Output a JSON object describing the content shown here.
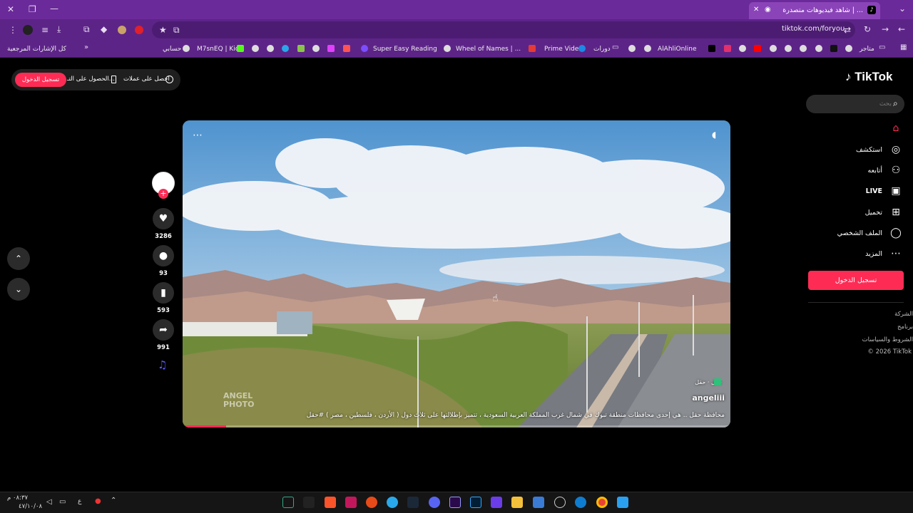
{
  "browser": {
    "tab_title": "شاهد فيديوهات متصدرة | ...",
    "url": "tiktok.com/foryou",
    "bookmarks": [
      "كل الإشارات المرجعية",
      "حسابي",
      "M7snEQ | Kick",
      "Super Easy Reading",
      "Wheel of Names | ...",
      "Prime Video",
      "دورات",
      "AlAhliOnline",
      "متاجر"
    ]
  },
  "promo": {
    "login": "تسجيل الدخول",
    "get_app": "الحصول على التـ...",
    "get_coins": "احصل على عملات"
  },
  "sidebar": {
    "logo": "TikTok",
    "search_placeholder": "بحث",
    "items": [
      {
        "label": "",
        "icon": "home-icon"
      },
      {
        "label": "استكشف",
        "icon": "compass-icon"
      },
      {
        "label": "أتابعه",
        "icon": "following-icon"
      },
      {
        "label": "LIVE",
        "icon": "live-icon"
      },
      {
        "label": "تحميل",
        "icon": "upload-icon"
      },
      {
        "label": "الملف الشخصي",
        "icon": "profile-icon"
      },
      {
        "label": "المزيد",
        "icon": "more-icon"
      }
    ],
    "login": "تسجيل الدخول",
    "footer": [
      "الشركة",
      "برنامج",
      "الشروط والسياسات",
      "© 2026 TikTok"
    ]
  },
  "video": {
    "author": "angeliii",
    "location": "حقل · حقل",
    "caption": "محافظة حقل .. هي إحدى محافظات منطقة تبوك في شمال غرب المملكة العربية السعودية ، تتميز بإطلالتها على ثلاث دول ( الأردن ، فلسطين ، مصر ) #حقل",
    "watermark": "ANGEL PHOTO",
    "progress": 0.08
  },
  "actions": {
    "likes": "3286",
    "comments": "93",
    "saves": "593",
    "shares": "991"
  },
  "taskbar": {
    "time": "٠٨:٣٧ م",
    "date": "٤٧/١٠/٠٨",
    "lang": "ع"
  },
  "colors": {
    "accent": "#fe2c55",
    "browser": "#6b2a9a"
  }
}
